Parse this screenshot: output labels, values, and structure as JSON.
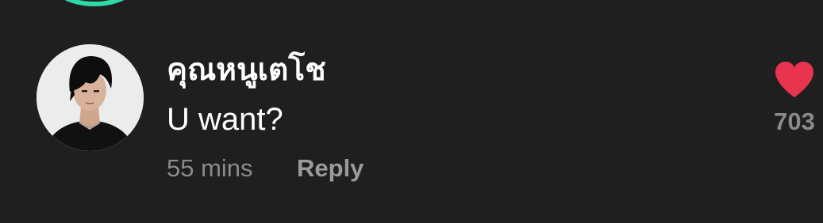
{
  "comment": {
    "username": "คุณหนูเตโช",
    "text": "U want?",
    "timestamp": "55 mins",
    "reply_label": "Reply",
    "like_count": "703",
    "liked": true,
    "avatar_icon": "profile-photo",
    "like_icon": "heart-icon"
  },
  "colors": {
    "background": "#1f1f1f",
    "text_primary": "#ffffff",
    "text_secondary": "#8a8a8a",
    "heart": "#e8344e",
    "previous_avatar_ring": "#2fd8a8"
  }
}
